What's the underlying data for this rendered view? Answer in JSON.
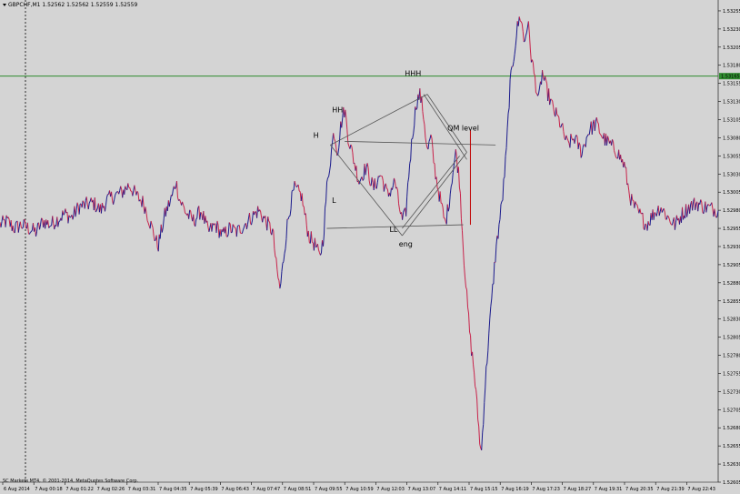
{
  "window": {
    "symbol_line": "GBPCHF,M1  1.52562 1.52562 1.52559 1.52559",
    "copyright": "SC Markets MT4, © 2001-2014, MetaQuotes Software Corp."
  },
  "colors": {
    "background": "#d4d4d4",
    "bull": "#1a1a8c",
    "bear": "#c8224a",
    "hline": "#2e8b2e",
    "price_tag": "#2e8b2e",
    "pattern": "#555555"
  },
  "chart_data": {
    "type": "line",
    "ylim": [
      1.52605,
      1.5327
    ],
    "y_ticks": [
      "1.53255",
      "1.53230",
      "1.53205",
      "1.53180",
      "1.53155",
      "1.53130",
      "1.53105",
      "1.53080",
      "1.53055",
      "1.53030",
      "1.53005",
      "1.52980",
      "1.52955",
      "1.52930",
      "1.52905",
      "1.52880",
      "1.52855",
      "1.52830",
      "1.52805",
      "1.52780",
      "1.52755",
      "1.52730",
      "1.52705",
      "1.52680",
      "1.52655",
      "1.52630",
      "1.52605"
    ],
    "x_ticks": [
      "6 Aug 2014",
      "7 Aug 00:18",
      "7 Aug 01:22",
      "7 Aug 02:26",
      "7 Aug 03:31",
      "7 Aug 04:35",
      "7 Aug 05:39",
      "7 Aug 06:43",
      "7 Aug 07:47",
      "7 Aug 08:51",
      "7 Aug 09:55",
      "7 Aug 10:59",
      "7 Aug 12:03",
      "7 Aug 13:07",
      "7 Aug 14:11",
      "7 Aug 15:15",
      "7 Aug 16:19",
      "7 Aug 17:23",
      "7 Aug 18:27",
      "7 Aug 19:31",
      "7 Aug 20:35",
      "7 Aug 21:39",
      "7 Aug 22:43"
    ],
    "horizontal_line": {
      "value": 1.53165,
      "label": "1.53165"
    },
    "price_path": [
      [
        0,
        1.5296
      ],
      [
        0.01,
        1.52965
      ],
      [
        0.02,
        1.52955
      ],
      [
        0.03,
        1.5296
      ],
      [
        0.05,
        1.5295
      ],
      [
        0.06,
        1.52965
      ],
      [
        0.07,
        1.5296
      ],
      [
        0.09,
        1.52975
      ],
      [
        0.1,
        1.5297
      ],
      [
        0.11,
        1.52985
      ],
      [
        0.13,
        1.5299
      ],
      [
        0.14,
        1.5298
      ],
      [
        0.15,
        1.52995
      ],
      [
        0.17,
        1.53005
      ],
      [
        0.18,
        1.53015
      ],
      [
        0.19,
        1.53
      ],
      [
        0.2,
        1.5299
      ],
      [
        0.21,
        1.5296
      ],
      [
        0.22,
        1.5293
      ],
      [
        0.23,
        1.52975
      ],
      [
        0.24,
        1.53
      ],
      [
        0.245,
        1.5302
      ],
      [
        0.25,
        1.52995
      ],
      [
        0.26,
        1.52975
      ],
      [
        0.27,
        1.52965
      ],
      [
        0.28,
        1.5298
      ],
      [
        0.29,
        1.5295
      ],
      [
        0.3,
        1.5296
      ],
      [
        0.31,
        1.52945
      ],
      [
        0.32,
        1.52955
      ],
      [
        0.33,
        1.5295
      ],
      [
        0.34,
        1.5296
      ],
      [
        0.35,
        1.5297
      ],
      [
        0.36,
        1.5298
      ],
      [
        0.37,
        1.52965
      ],
      [
        0.38,
        1.5295
      ],
      [
        0.385,
        1.529
      ],
      [
        0.39,
        1.5287
      ],
      [
        0.4,
        1.5296
      ],
      [
        0.405,
        1.5299
      ],
      [
        0.41,
        1.5301
      ],
      [
        0.42,
        1.53
      ],
      [
        0.425,
        1.5297
      ],
      [
        0.43,
        1.52945
      ],
      [
        0.44,
        1.5293
      ],
      [
        0.445,
        1.52915
      ],
      [
        0.45,
        1.5294
      ],
      [
        0.455,
        1.5301
      ],
      [
        0.46,
        1.5305
      ],
      [
        0.465,
        1.5309
      ],
      [
        0.47,
        1.5306
      ],
      [
        0.475,
        1.531
      ],
      [
        0.48,
        1.5312
      ],
      [
        0.485,
        1.5308
      ],
      [
        0.49,
        1.5306
      ],
      [
        0.5,
        1.5302
      ],
      [
        0.51,
        1.5304
      ],
      [
        0.52,
        1.5301
      ],
      [
        0.53,
        1.5303
      ],
      [
        0.54,
        1.53
      ],
      [
        0.55,
        1.5302
      ],
      [
        0.555,
        1.5299
      ],
      [
        0.56,
        1.52965
      ],
      [
        0.565,
        1.52975
      ],
      [
        0.57,
        1.5304
      ],
      [
        0.575,
        1.5309
      ],
      [
        0.58,
        1.5313
      ],
      [
        0.585,
        1.5314
      ],
      [
        0.59,
        1.5311
      ],
      [
        0.595,
        1.5306
      ],
      [
        0.6,
        1.5308
      ],
      [
        0.605,
        1.5304
      ],
      [
        0.61,
        1.5301
      ],
      [
        0.615,
        1.52985
      ],
      [
        0.62,
        1.5296
      ],
      [
        0.625,
        1.5299
      ],
      [
        0.63,
        1.5303
      ],
      [
        0.635,
        1.5306
      ],
      [
        0.64,
        1.5302
      ],
      [
        0.645,
        1.5293
      ],
      [
        0.65,
        1.5286
      ],
      [
        0.655,
        1.528
      ],
      [
        0.66,
        1.5276
      ],
      [
        0.665,
        1.527
      ],
      [
        0.67,
        1.5264
      ],
      [
        0.675,
        1.5273
      ],
      [
        0.68,
        1.528
      ],
      [
        0.685,
        1.5286
      ],
      [
        0.69,
        1.5292
      ],
      [
        0.695,
        1.5296
      ],
      [
        0.7,
        1.53
      ],
      [
        0.705,
        1.5306
      ],
      [
        0.71,
        1.5315
      ],
      [
        0.715,
        1.5319
      ],
      [
        0.72,
        1.5323
      ],
      [
        0.725,
        1.5325
      ],
      [
        0.73,
        1.5321
      ],
      [
        0.735,
        1.5324
      ],
      [
        0.74,
        1.5319
      ],
      [
        0.745,
        1.5316
      ],
      [
        0.75,
        1.5313
      ],
      [
        0.755,
        1.5317
      ],
      [
        0.76,
        1.5315
      ],
      [
        0.77,
        1.5312
      ],
      [
        0.78,
        1.531
      ],
      [
        0.79,
        1.5307
      ],
      [
        0.8,
        1.5308
      ],
      [
        0.81,
        1.5306
      ],
      [
        0.82,
        1.5309
      ],
      [
        0.83,
        1.531
      ],
      [
        0.84,
        1.5308
      ],
      [
        0.85,
        1.5307
      ],
      [
        0.86,
        1.5306
      ],
      [
        0.87,
        1.5304
      ],
      [
        0.875,
        1.5301
      ],
      [
        0.88,
        1.5299
      ],
      [
        0.89,
        1.52975
      ],
      [
        0.9,
        1.5296
      ],
      [
        0.91,
        1.52975
      ],
      [
        0.92,
        1.52985
      ],
      [
        0.93,
        1.5297
      ],
      [
        0.94,
        1.5296
      ],
      [
        0.95,
        1.52975
      ],
      [
        0.96,
        1.52985
      ],
      [
        0.97,
        1.5299
      ],
      [
        0.98,
        1.52985
      ],
      [
        1.0,
        1.5298
      ]
    ],
    "annotations": [
      {
        "text": "HHH",
        "x": 0.575,
        "y": 1.53165
      },
      {
        "text": "HH",
        "x": 0.47,
        "y": 1.53115
      },
      {
        "text": "H",
        "x": 0.44,
        "y": 1.5308
      },
      {
        "text": "QM level",
        "x": 0.645,
        "y": 1.5309
      },
      {
        "text": "L",
        "x": 0.465,
        "y": 1.5299
      },
      {
        "text": "LL",
        "x": 0.548,
        "y": 1.5295
      },
      {
        "text": "eng",
        "x": 0.565,
        "y": 1.5293
      }
    ],
    "pattern_lines": [
      {
        "from": [
          0.46,
          1.5307
        ],
        "to": [
          0.595,
          1.5314
        ]
      },
      {
        "from": [
          0.595,
          1.5314
        ],
        "to": [
          0.65,
          1.5306
        ]
      },
      {
        "from": [
          0.65,
          1.5306
        ],
        "to": [
          0.56,
          1.52945
        ]
      },
      {
        "from": [
          0.56,
          1.52945
        ],
        "to": [
          0.46,
          1.5307
        ]
      },
      {
        "from": [
          0.59,
          1.5314
        ],
        "to": [
          0.65,
          1.5305
        ]
      },
      {
        "from": [
          0.56,
          1.52955
        ],
        "to": [
          0.64,
          1.53055
        ]
      },
      {
        "from": [
          0.48,
          1.53075
        ],
        "to": [
          0.69,
          1.5307
        ]
      },
      {
        "from": [
          0.455,
          1.52955
        ],
        "to": [
          0.645,
          1.5296
        ]
      }
    ],
    "qm_marker": {
      "x": 0.655,
      "y_top": 1.5309,
      "y_bottom": 1.5296
    }
  }
}
